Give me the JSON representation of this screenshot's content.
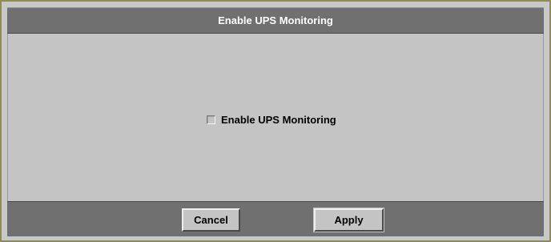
{
  "dialog": {
    "title": "Enable UPS Monitoring"
  },
  "content": {
    "checkbox": {
      "label": "Enable UPS Monitoring",
      "checked": false
    }
  },
  "buttons": {
    "cancel_label": "Cancel",
    "apply_label": "Apply"
  }
}
